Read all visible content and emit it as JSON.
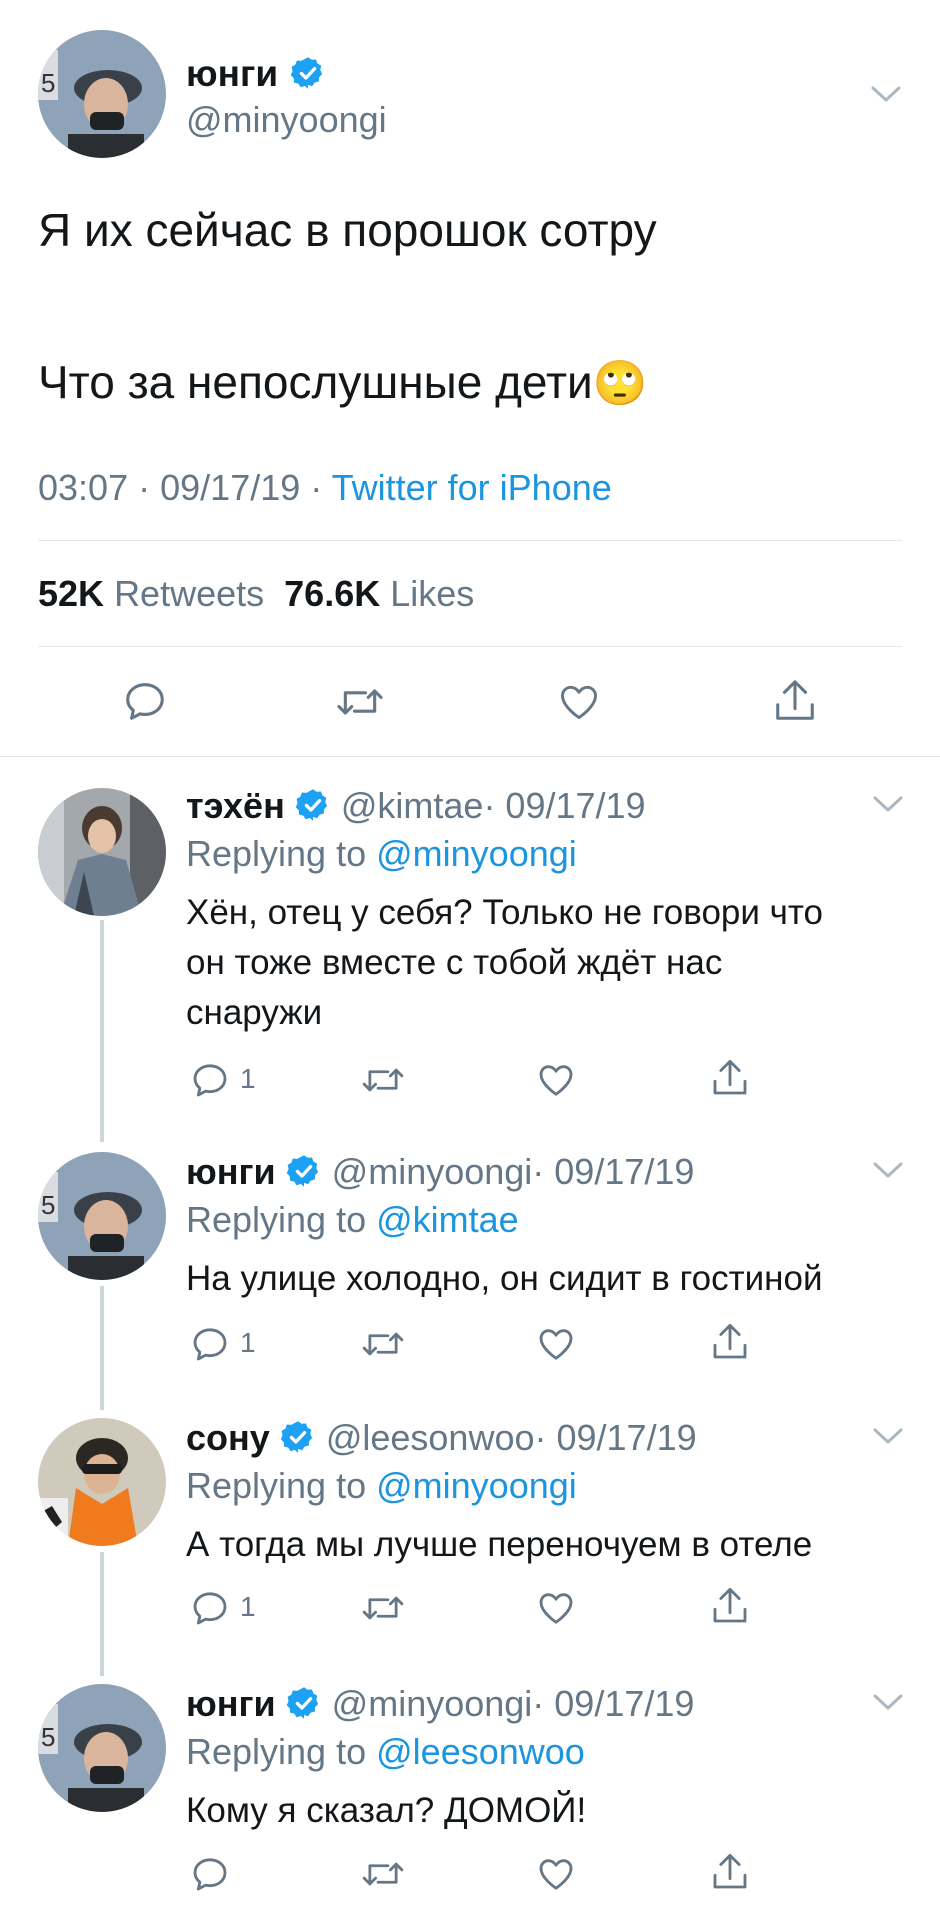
{
  "main_tweet": {
    "name": "юнги",
    "handle": "@minyoongi",
    "text_line1": "Я их сейчас в порошок сотру",
    "text_line2": "Что за непослушные дети",
    "emoji": "🙄",
    "time": "03:07",
    "date": "09/17/19",
    "separator": "·",
    "source": "Twitter for iPhone",
    "retweets_count": "52K",
    "retweets_label": "Retweets",
    "likes_count": "76.6K",
    "likes_label": "Likes"
  },
  "replies": [
    {
      "name": "тэхён",
      "handle": "@kimtae",
      "date": "· 09/17/19",
      "replying_prefix": "Replying to",
      "replying_to": "@minyoongi",
      "lines": [
        "Хён, отец у себя? Только не говори что",
        "он тоже вместе с тобой ждёт нас",
        "снаружи"
      ],
      "reply_count": "1"
    },
    {
      "name": "юнги",
      "handle": "@minyoongi",
      "date": "· 09/17/19",
      "replying_prefix": "Replying to",
      "replying_to": "@kimtae",
      "lines": [
        "На улице холодно, он сидит в гостиной"
      ],
      "reply_count": "1"
    },
    {
      "name": "сону",
      "handle": "@leesonwoo",
      "date": "· 09/17/19",
      "replying_prefix": "Replying to",
      "replying_to": "@minyoongi",
      "lines": [
        "А тогда мы лучше переночуем в отеле"
      ],
      "reply_count": "1"
    },
    {
      "name": "юнги",
      "handle": "@minyoongi",
      "date": "· 09/17/19",
      "replying_prefix": "Replying to",
      "replying_to": "@leesonwoo",
      "lines": [
        "Кому я сказал? ДОМОЙ!"
      ],
      "reply_count": ""
    }
  ],
  "icons": {
    "reply": "reply-icon",
    "retweet": "retweet-icon",
    "like": "heart-icon",
    "share": "share-icon",
    "verified": "verified-badge-icon",
    "menu": "chevron-down-icon"
  },
  "colors": {
    "link": "#1b95e0",
    "muted": "#657786",
    "text": "#14171a",
    "divider": "#e1e8ed",
    "verified": "#1da1f2"
  }
}
